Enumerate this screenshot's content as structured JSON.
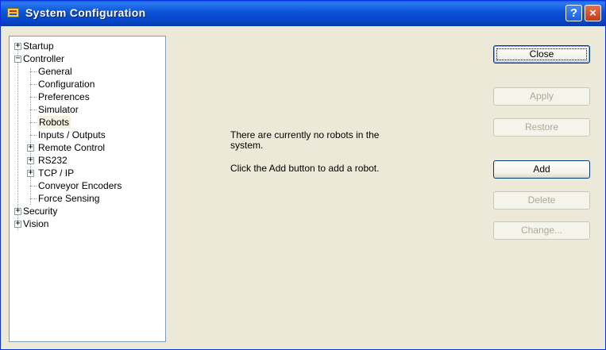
{
  "window": {
    "title": "System Configuration",
    "help_glyph": "?",
    "close_glyph": "×"
  },
  "tree": [
    {
      "label": "Startup",
      "expander": "+"
    },
    {
      "label": "Controller",
      "expander": "−"
    },
    {
      "label": "General"
    },
    {
      "label": "Configuration"
    },
    {
      "label": "Preferences"
    },
    {
      "label": "Simulator"
    },
    {
      "label": "Robots",
      "selected": true
    },
    {
      "label": "Inputs / Outputs"
    },
    {
      "label": "Remote Control",
      "expander": "+"
    },
    {
      "label": "RS232",
      "expander": "+"
    },
    {
      "label": "TCP / IP",
      "expander": "+"
    },
    {
      "label": "Conveyor Encoders"
    },
    {
      "label": "Force Sensing"
    },
    {
      "label": "Security",
      "expander": "+"
    },
    {
      "label": "Vision",
      "expander": "+"
    }
  ],
  "message": {
    "line1": "There are currently no robots in the",
    "line2": "system.",
    "line3": "Click the Add button to add a robot."
  },
  "buttons": {
    "close": "Close",
    "apply": "Apply",
    "restore": "Restore",
    "add": "Add",
    "delete": "Delete",
    "change": "Change..."
  }
}
